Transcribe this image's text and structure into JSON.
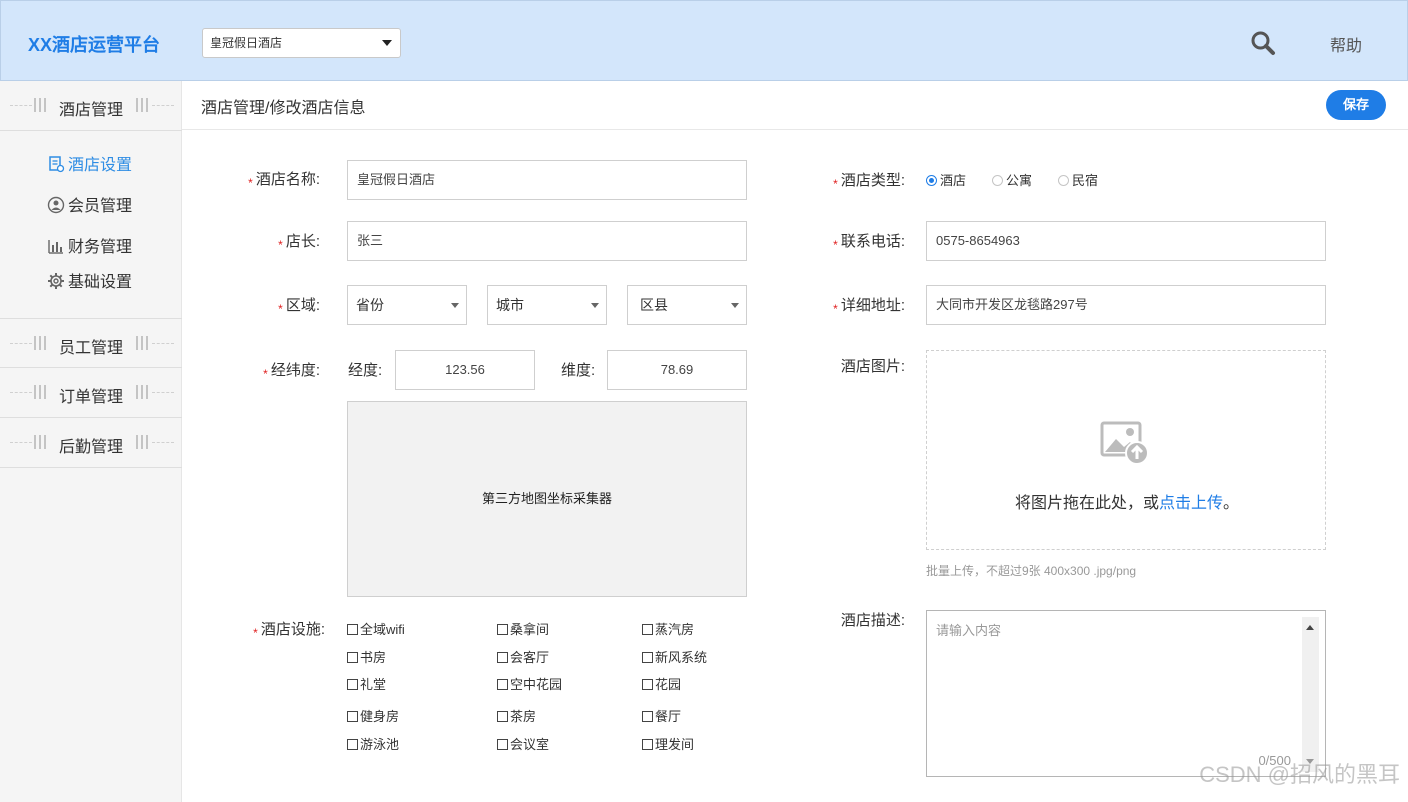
{
  "header": {
    "logo": "XX酒店运营平台",
    "hotel_select": "皇冠假日酒店",
    "search_icon": "search-icon",
    "help": "帮助"
  },
  "sidebar": {
    "groups": [
      {
        "title": "酒店管理"
      },
      {
        "title": "员工管理"
      },
      {
        "title": "订单管理"
      },
      {
        "title": "后勤管理"
      }
    ],
    "sub_items": [
      {
        "label": "酒店设置",
        "icon": "hotel-settings-icon",
        "active": true
      },
      {
        "label": "会员管理",
        "icon": "member-icon"
      },
      {
        "label": "财务管理",
        "icon": "finance-chart-icon"
      },
      {
        "label": "基础设置",
        "icon": "gear-icon"
      }
    ]
  },
  "main": {
    "breadcrumb": "酒店管理/修改酒店信息",
    "save_label": "保存",
    "form": {
      "name_label": "酒店名称:",
      "name_value": "皇冠假日酒店",
      "manager_label": "店长:",
      "manager_value": "张三",
      "region_label": "区域:",
      "province": "省份",
      "city": "城市",
      "district": "区县",
      "coord_label": "经纬度:",
      "lng_label": "经度:",
      "lng_value": "123.56",
      "lat_label": "维度:",
      "lat_value": "78.69",
      "map_text": "第三方地图坐标采集器",
      "facilities_label": "酒店设施:",
      "facilities": [
        "全域wifi",
        "桑拿间",
        "蒸汽房",
        "书房",
        "会客厅",
        "新风系统",
        "礼堂",
        "空中花园",
        "花园",
        "健身房",
        "茶房",
        "餐厅",
        "游泳池",
        "会议室",
        "理发间"
      ],
      "type_label": "酒店类型:",
      "types": [
        "酒店",
        "公寓",
        "民宿"
      ],
      "type_selected": "酒店",
      "phone_label": "联系电话:",
      "phone_value": "0575-8654963",
      "address_label": "详细地址:",
      "address_value": "大同市开发区龙毯路297号",
      "image_label": "酒店图片:",
      "upload_text": "将图片拖在此处，或",
      "upload_link": "点击上传",
      "upload_end": "。",
      "upload_hint": "批量上传，不超过9张 400x300 .jpg/png",
      "desc_label": "酒店描述:",
      "desc_placeholder": "请输入内容",
      "desc_count": "0/500"
    }
  },
  "watermark": "CSDN @招风的黑耳",
  "colors": {
    "accent": "#1f7de6",
    "header_bg": "#d3e6fb",
    "required": "#e02020"
  }
}
